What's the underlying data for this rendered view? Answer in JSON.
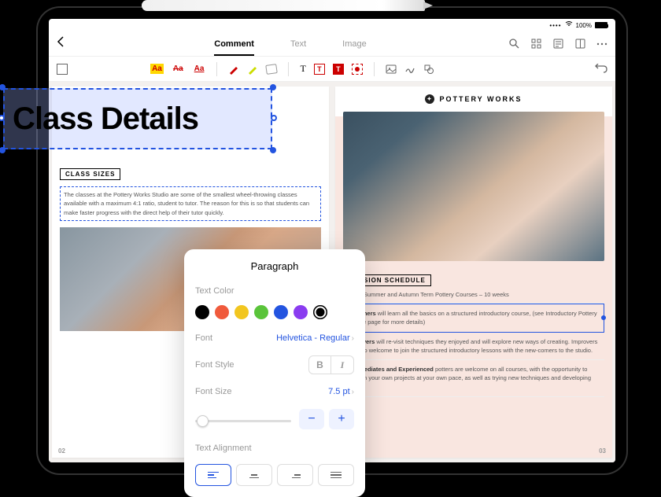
{
  "statusbar": {
    "battery": "100%"
  },
  "tabs": {
    "comment": "Comment",
    "text": "Text",
    "image": "Image"
  },
  "toolbar": {
    "aa": "Aa",
    "t": "T"
  },
  "selected_text": "Class Details",
  "page_left": {
    "class_sizes_header": "CLASS SIZES",
    "class_sizes_body": "The classes at the Pottery Works Studio are some of the smallest wheel-throwing classes available with a maximum 4:1 ratio, student to tutor. The reason for this is so that students can make faster progress with the direct help of their tutor quickly.",
    "page_number": "02"
  },
  "page_right": {
    "brand": "POTTERY WORKS",
    "schedule_header": "SESSION SCHEDULE",
    "schedule_intro": "Spring, Summer and Autumn Term Pottery Courses – 10 weeks",
    "block_beginners_label": "Beginners",
    "block_beginners_text": " will learn all the basics on a structured introductory course, (see Introductory Pottery Course page for more details)",
    "block_improvers_label": "Improvers",
    "block_improvers_text": " will re-visit techniques they enjoyed and will explore new ways of creating. Improvers are also welcome to join the structured introductory lessons with the new-comers to the studio.",
    "block_interm_label": "Intermediates and Experienced",
    "block_interm_text": " potters are welcome on all courses, with the opportunity to work on your own projects at your own pace, as well as trying new techniques and developing skills.",
    "page_number": "03"
  },
  "popover": {
    "title": "Paragraph",
    "text_color_label": "Text Color",
    "colors": [
      "#000000",
      "#f05a3c",
      "#f2c61f",
      "#5ac43a",
      "#2354e0",
      "#8a3cf0",
      "#000000"
    ],
    "font_label": "Font",
    "font_value": "Helvetica - Regular",
    "font_style_label": "Font Style",
    "font_size_label": "Font Size",
    "font_size_value": "7.5 pt",
    "decrease": "−",
    "increase": "+",
    "alignment_label": "Text Alignment",
    "bold": "B",
    "italic": "I"
  }
}
